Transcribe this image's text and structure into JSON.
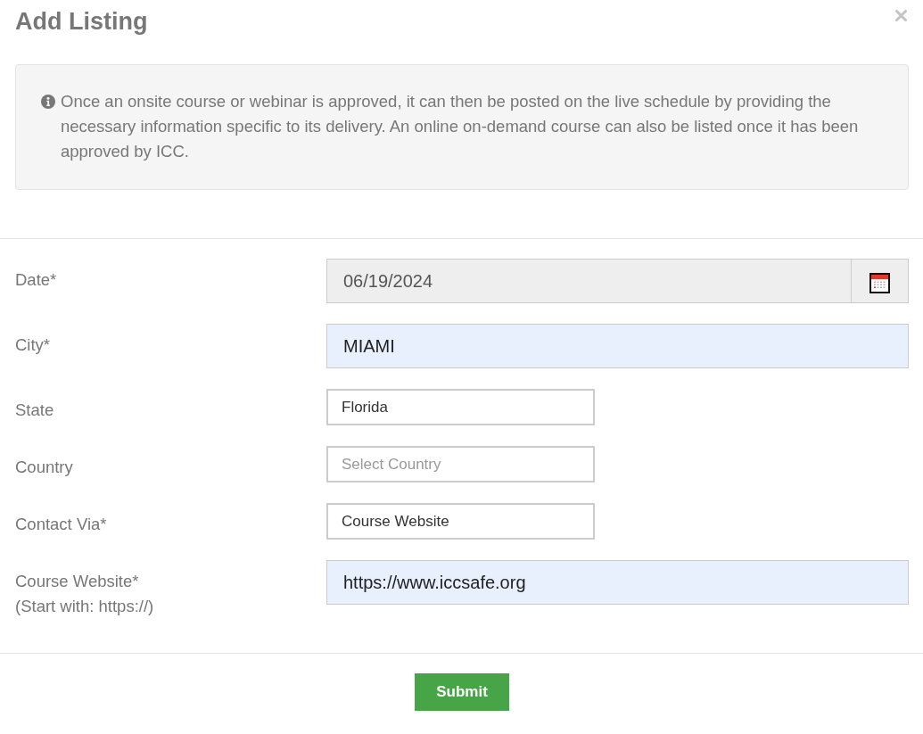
{
  "dialog": {
    "title": "Add Listing"
  },
  "notice": {
    "text": "Once an onsite course or webinar is approved, it can then be posted on the live schedule by providing the necessary information specific to its delivery. An online on-demand course can also be listed once it has been approved by ICC."
  },
  "fields": [
    {
      "kind": "date",
      "label": "Date*",
      "value": "06/19/2024",
      "readonly": true,
      "autofilled": false
    },
    {
      "kind": "text",
      "label": "City*",
      "value": "MIAMI",
      "readonly": false,
      "autofilled": true
    },
    {
      "kind": "select",
      "label": "State",
      "value": "Florida",
      "readonly": false,
      "autofilled": false
    },
    {
      "kind": "select",
      "label": "Country",
      "placeholder": "Select Country",
      "readonly": false,
      "autofilled": false
    },
    {
      "kind": "select",
      "label": "Contact Via*",
      "value": "Course Website",
      "readonly": false,
      "autofilled": false
    },
    {
      "kind": "text",
      "label": "Course Website*",
      "hint": "(Start with: https://)",
      "value": "https://www.iccsafe.org",
      "readonly": false,
      "autofilled": true
    }
  ],
  "submit_button": {
    "label": "Submit"
  }
}
